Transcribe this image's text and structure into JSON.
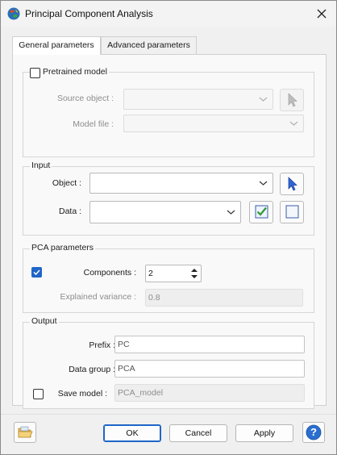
{
  "window": {
    "title": "Principal Component Analysis"
  },
  "tabs": [
    {
      "label": "General parameters",
      "active": true
    },
    {
      "label": "Advanced parameters",
      "active": false
    }
  ],
  "pretrained": {
    "checkbox_label": "Pretrained model",
    "checked": false,
    "source_object_label": "Source object :",
    "model_file_label": "Model file :"
  },
  "input": {
    "group_title": "Input",
    "object_label": "Object :",
    "data_label": "Data :"
  },
  "pca": {
    "group_title": "PCA parameters",
    "components_label": "Components :",
    "components_value": "2",
    "components_checked": true,
    "explained_variance_label": "Explained variance :",
    "explained_variance_value": "0.8"
  },
  "output": {
    "group_title": "Output",
    "prefix_label": "Prefix :",
    "prefix_value": "PC",
    "data_group_label": "Data group :",
    "data_group_value": "PCA",
    "save_model_label": "Save model :",
    "save_model_checked": false,
    "save_model_value": "PCA_model"
  },
  "footer": {
    "ok_label": "OK",
    "cancel_label": "Cancel",
    "apply_label": "Apply",
    "help_symbol": "?"
  },
  "colors": {
    "accent": "#1f66c7",
    "pointer_blue": "#2f64d6",
    "check_green": "#2e9a2e"
  }
}
